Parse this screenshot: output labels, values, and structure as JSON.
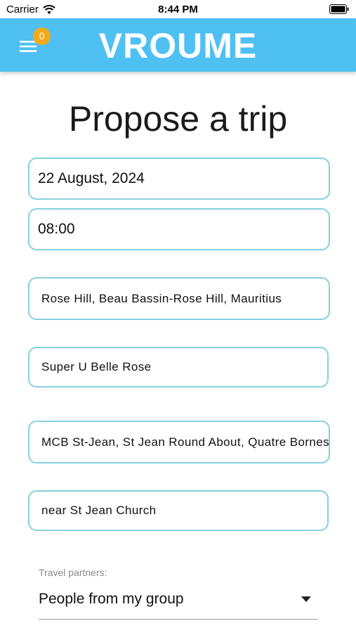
{
  "status_bar": {
    "carrier": "Carrier",
    "time": "8:44 PM"
  },
  "header": {
    "title": "VROUME",
    "notification_count": "0",
    "menu_icon": "hamburger-menu-icon"
  },
  "page": {
    "title": "Propose a trip"
  },
  "form": {
    "date_value": "22 August, 2024",
    "time_value": "08:00",
    "departure_location": "Rose Hill, Beau Bassin-Rose Hill, Mauritius",
    "departure_detail": "Super U Belle Rose",
    "arrival_location": "MCB St-Jean, St Jean Round About, Quatre Bornes, Mauritius",
    "arrival_detail": "near St Jean Church",
    "travel_partners_label": "Travel partners:",
    "travel_partners_value": "People from my group"
  },
  "colors": {
    "header_bg": "#4fc0f2",
    "badge_bg": "#f3a91c",
    "field_border": "#86d0de"
  }
}
